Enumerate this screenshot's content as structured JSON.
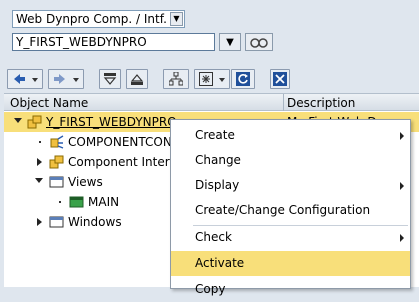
{
  "selectors": {
    "object_type": "Web Dynpro Comp. / Intf.",
    "object_name": "Y_FIRST_WEBDYNPRO"
  },
  "toolbar": {
    "buttons": [
      "back",
      "forward",
      "expand",
      "collapse",
      "hierarchy",
      "multi-select",
      "refresh",
      "close"
    ]
  },
  "columns": {
    "object_name": "Object Name",
    "description": "Description"
  },
  "tree": {
    "root": {
      "label": "Y_FIRST_WEBDYNPRO",
      "description": "My First Web Dynpro"
    },
    "items": [
      {
        "label": "COMPONENTCON"
      },
      {
        "label": "Component Interf"
      },
      {
        "label": "Views"
      },
      {
        "label": "MAIN"
      },
      {
        "label": "Windows"
      }
    ]
  },
  "context_menu": {
    "items": [
      {
        "label": "Create",
        "submenu": true
      },
      {
        "label": "Change",
        "submenu": false
      },
      {
        "label": "Display",
        "submenu": true
      },
      {
        "label": "Create/Change Configuration",
        "submenu": false
      },
      {
        "label": "Check",
        "submenu": true
      },
      {
        "label": "Activate",
        "submenu": false,
        "highlighted": true
      },
      {
        "label": "Copy",
        "submenu": false
      }
    ]
  },
  "colors": {
    "highlight": "#f8df7a",
    "background": "#dfe6ee"
  }
}
